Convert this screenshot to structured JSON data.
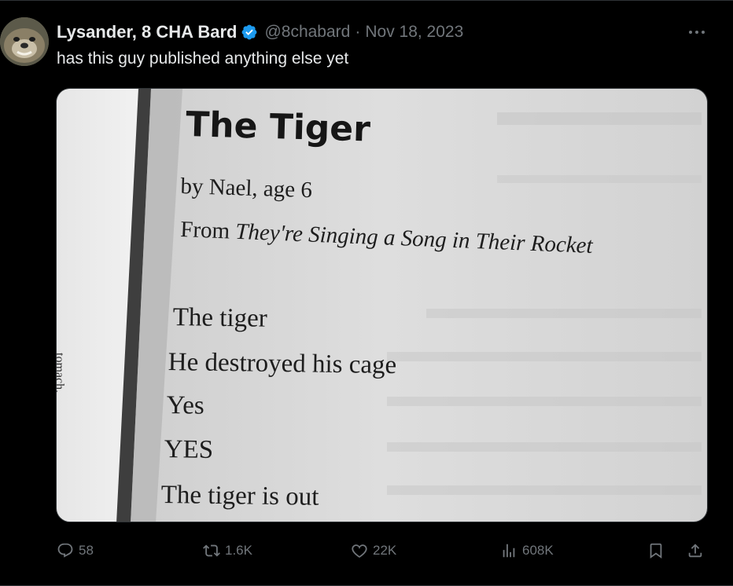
{
  "tweet": {
    "author_name": "Lysander, 8 CHA Bard",
    "handle": "@8chabard",
    "separator": "·",
    "date": "Nov 18, 2023",
    "text": "has this guy published anything else yet"
  },
  "media": {
    "title": "The Tiger",
    "byline": "by Nael, age 6",
    "from_prefix": "From ",
    "from_title": "They're Singing a Song in Their Rocket",
    "poem_lines": [
      "The tiger",
      "He destroyed his cage",
      "Yes",
      "YES",
      "The tiger is out"
    ],
    "margin_word": "tomach."
  },
  "actions": {
    "replies": "58",
    "reposts": "1.6K",
    "likes": "22K",
    "views": "608K"
  },
  "colors": {
    "background": "#000000",
    "text_primary": "#e7e9ea",
    "text_secondary": "#71767b",
    "verified_badge": "#1d9bf0",
    "divider": "#2f3336"
  },
  "icons": [
    "verified-badge-icon",
    "more-icon",
    "reply-icon",
    "repost-icon",
    "like-icon",
    "views-icon",
    "bookmark-icon",
    "share-icon"
  ]
}
